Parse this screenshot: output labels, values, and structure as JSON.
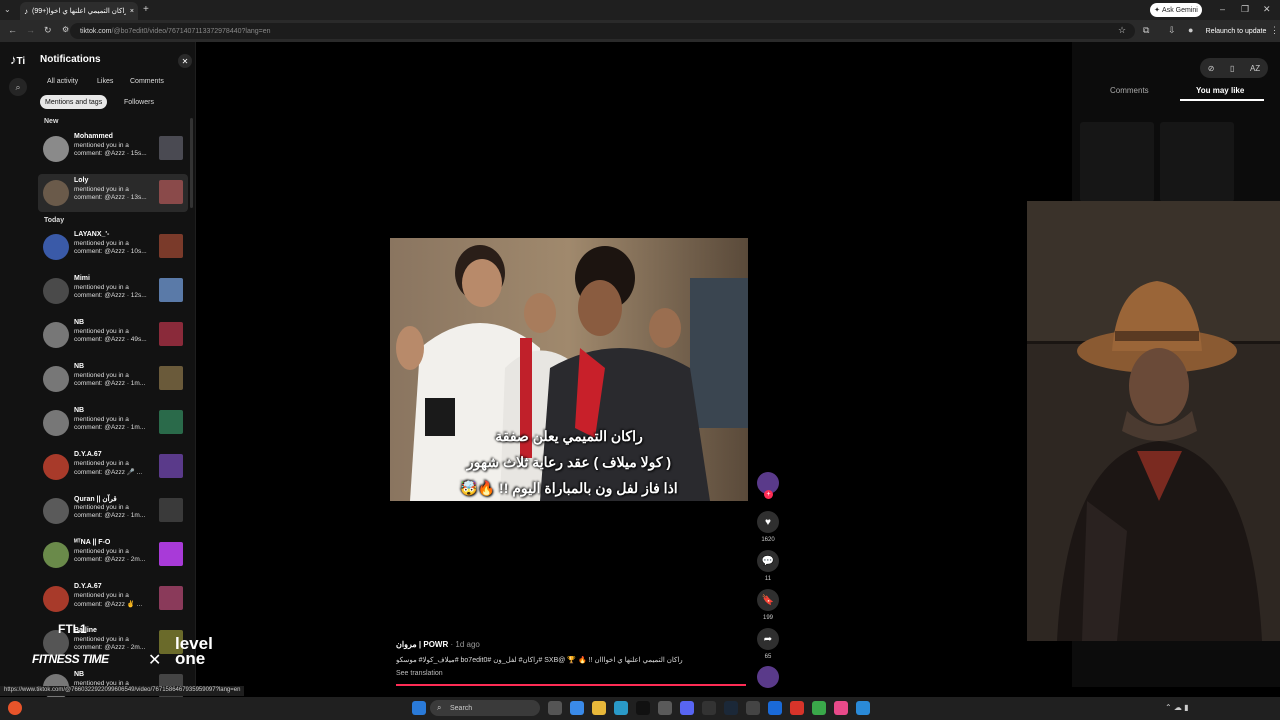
{
  "browser": {
    "tab_title": "(99+)راكان التميمي اعلنها ي اخوا",
    "new_tab": "+",
    "url_host": "tiktok.com",
    "url_path": "/@bo7edit0/video/7671407113372978440?lang=en",
    "ask_gemini": "Ask Gemini",
    "relaunch": "Relaunch to update",
    "status_url": "https://www.tiktok.com/@7660322922099606549/video/7671586467935959097?lang=en"
  },
  "notifications": {
    "title": "Notifications",
    "filters_row1": [
      "All activity",
      "Likes",
      "Comments"
    ],
    "filters_row2": [
      "Mentions and tags",
      "Followers"
    ],
    "sections": {
      "new": "New",
      "today": "Today"
    },
    "items": [
      {
        "name": "Mohammed",
        "line1": "mentioned you in a",
        "line2": "comment: @Azzz · 15s..."
      },
      {
        "name": "Loly",
        "line1": "mentioned you in a",
        "line2": "comment: @Azzz · 13s..."
      },
      {
        "name": "LAYANX_'-",
        "line1": "mentioned you in a",
        "line2": "comment: @Azzz · 10s..."
      },
      {
        "name": "Mimi",
        "line1": "mentioned you in a",
        "line2": "comment: @Azzz · 12s..."
      },
      {
        "name": "NB",
        "line1": "mentioned you in a",
        "line2": "comment: @Azzz · 49s..."
      },
      {
        "name": "NB",
        "line1": "mentioned you in a",
        "line2": "comment: @Azzz · 1m..."
      },
      {
        "name": "NB",
        "line1": "mentioned you in a",
        "line2": "comment: @Azzz · 1m..."
      },
      {
        "name": "D.Y.A.67",
        "line1": "mentioned you in a",
        "line2": "comment: @Azzz 🎤 ..."
      },
      {
        "name": "Quran || قرآن",
        "line1": "mentioned you in a",
        "line2": "comment: @Azzz · 1m..."
      },
      {
        "name": "ᴹᵀNA || F-O",
        "line1": "mentioned you in a",
        "line2": "comment: @Azzz · 2m..."
      },
      {
        "name": "D.Y.A.67",
        "line1": "mentioned you in a",
        "line2": "comment: @Azzz ✌ ..."
      },
      {
        "name": "Bailine",
        "line1": "mentioned you in a",
        "line2": "comment: @Azzz · 2m..."
      },
      {
        "name": "NB",
        "line1": "mentioned you in a",
        "line2": ""
      }
    ]
  },
  "video": {
    "caption1": "راكان التميمي يعلن صفقة",
    "caption2": "( كولا ميلاف ) عقد رعاية ثلاث شهور",
    "caption3": "اذا فاز لفل ون بالمباراة اليوم !! 🔥🤯",
    "author": "مروان | POWR",
    "ago": "· 1d ago",
    "description": "ميلاف_كولا# موسكو# bo7edit0# راكان# لفل_ون# SXB@ 🏆 🔥 !! راكان التميمي اعلنها ي اخوااان",
    "see_translation": "See translation"
  },
  "actions": {
    "likes": "1620",
    "comments": "11",
    "saves": "199",
    "shares": "65"
  },
  "right_panel": {
    "tab_comments": "Comments",
    "tab_you_may_like": "You may like"
  },
  "brand": {
    "ftl": "FTL1",
    "fitness": "FITNESS TIME",
    "x": "✕",
    "level": "level one"
  },
  "taskbar": {
    "search": "Search"
  },
  "colors": {
    "accent": "#fe2c55",
    "bg": "#000000"
  }
}
